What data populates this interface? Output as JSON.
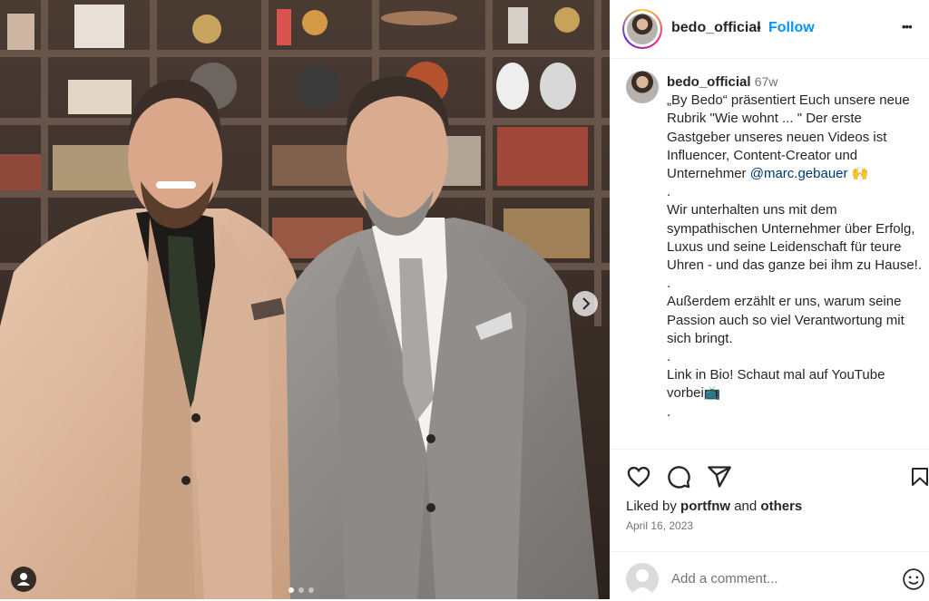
{
  "post": {
    "username": "bedo_official",
    "follow_dot": "•",
    "follow_label": "Follow",
    "more_label": "•••"
  },
  "caption": {
    "username": "bedo_official",
    "age": "67w",
    "lines": [
      "„By Bedo“ präsentiert Euch unsere neue Rubrik \"Wie wohnt ... \" Der erste Gastgeber unseres neuen Videos ist Influencer, Content-Creator und Unternehmer ",
      ".",
      "Wir unterhalten uns mit dem sympathischen Unternehmer über Erfolg, Luxus und seine Leidenschaft für teure Uhren - und das ganze bei ihm zu Hause!.",
      ".",
      "Außerdem erzählt er uns, warum seine Passion auch so viel Verantwortung mit sich bringt.",
      ".",
      "Link in Bio! Schaut mal auf YouTube vorbei",
      "."
    ],
    "mention": "@marc.gebauer",
    "emoji_1": "🙌",
    "emoji_2": "📺"
  },
  "engagement": {
    "liked_by_prefix": "Liked by ",
    "liked_by_user": "portfnw",
    "liked_by_and": " and ",
    "liked_by_others": "others",
    "date": "April 16, 2023"
  },
  "comment": {
    "placeholder": "Add a comment..."
  },
  "colors": {
    "accent": "#0095f6",
    "mention": "#00376b",
    "muted": "#737373"
  },
  "icons": [
    "heart-icon",
    "comment-icon",
    "share-icon",
    "bookmark-icon",
    "emoji-icon",
    "more-icon",
    "user-tag-icon",
    "carousel-next-icon"
  ]
}
